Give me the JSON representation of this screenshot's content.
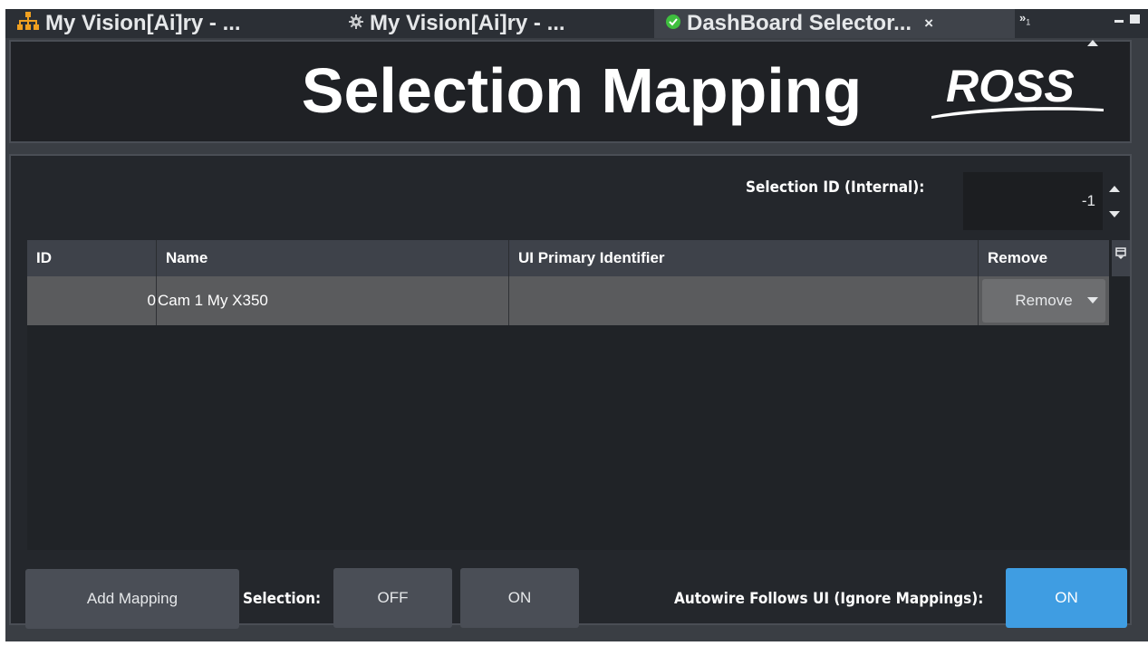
{
  "tabs": [
    {
      "label": "My Vision[Ai]ry - ...",
      "icon": "hierarchy-icon",
      "icon_color": "#f0a020",
      "active": false
    },
    {
      "label": "My Vision[Ai]ry - ...",
      "icon": "gear-icon",
      "icon_color": "#c8cacc",
      "active": false
    },
    {
      "label": "DashBoard Selector...",
      "icon": "check-circle-icon",
      "icon_color": "#3fbf3f",
      "active": true,
      "close": "×"
    }
  ],
  "tab_overflow": {
    "symbol": "»",
    "count": "1"
  },
  "header": {
    "title": "Selection Mapping",
    "logo_text": "ROSS"
  },
  "selection_id": {
    "label": "Selection ID (Internal):",
    "value": "-1"
  },
  "table": {
    "columns": [
      "ID",
      "Name",
      "UI Primary Identifier",
      "Remove"
    ],
    "rows": [
      {
        "id": "0",
        "name": "Cam 1 My X350",
        "ui_primary_identifier": "",
        "remove_label": "Remove"
      }
    ]
  },
  "controls": {
    "add_mapping_label": "Add Mapping",
    "selection_label": "Selection:",
    "selection_off_label": "OFF",
    "selection_on_label": "ON",
    "autowire_label": "Autowire Follows UI (Ignore Mappings):",
    "autowire_on_label": "ON",
    "accent_color": "#3f9de2"
  }
}
